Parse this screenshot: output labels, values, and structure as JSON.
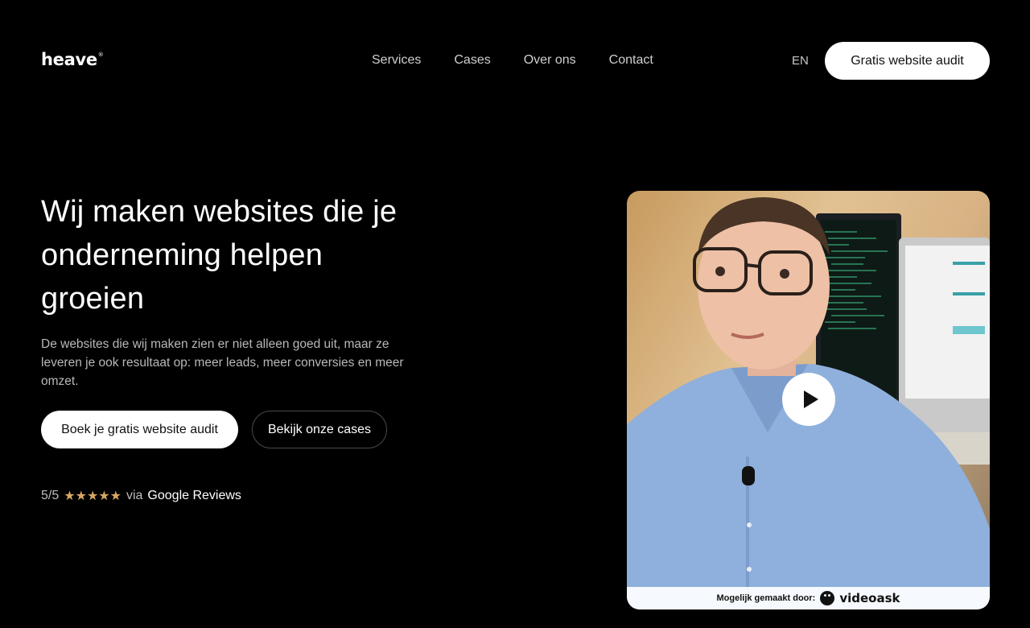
{
  "header": {
    "logo": "heave",
    "logo_mark": "®",
    "nav": [
      "Services",
      "Cases",
      "Over ons",
      "Contact"
    ],
    "lang": "EN",
    "cta": "Gratis website audit"
  },
  "hero": {
    "title": "Wij maken websites die je onderneming helpen groeien",
    "subtitle": "De websites die wij maken zien er niet alleen goed uit, maar ze leveren je ook resultaat op: meer leads, meer conversies en meer omzet.",
    "primary_button": "Boek je gratis website audit",
    "secondary_button": "Bekijk onze cases",
    "rating": {
      "score": "5/5",
      "stars": "★★★★★",
      "via": "via",
      "source": "Google Reviews"
    }
  },
  "video": {
    "made_by_label": "Mogelijk gemaakt door:",
    "brand": "videoask",
    "play_icon": "play-icon"
  },
  "colors": {
    "background": "#000000",
    "star": "#d9a860",
    "button_bg": "#ffffff"
  }
}
